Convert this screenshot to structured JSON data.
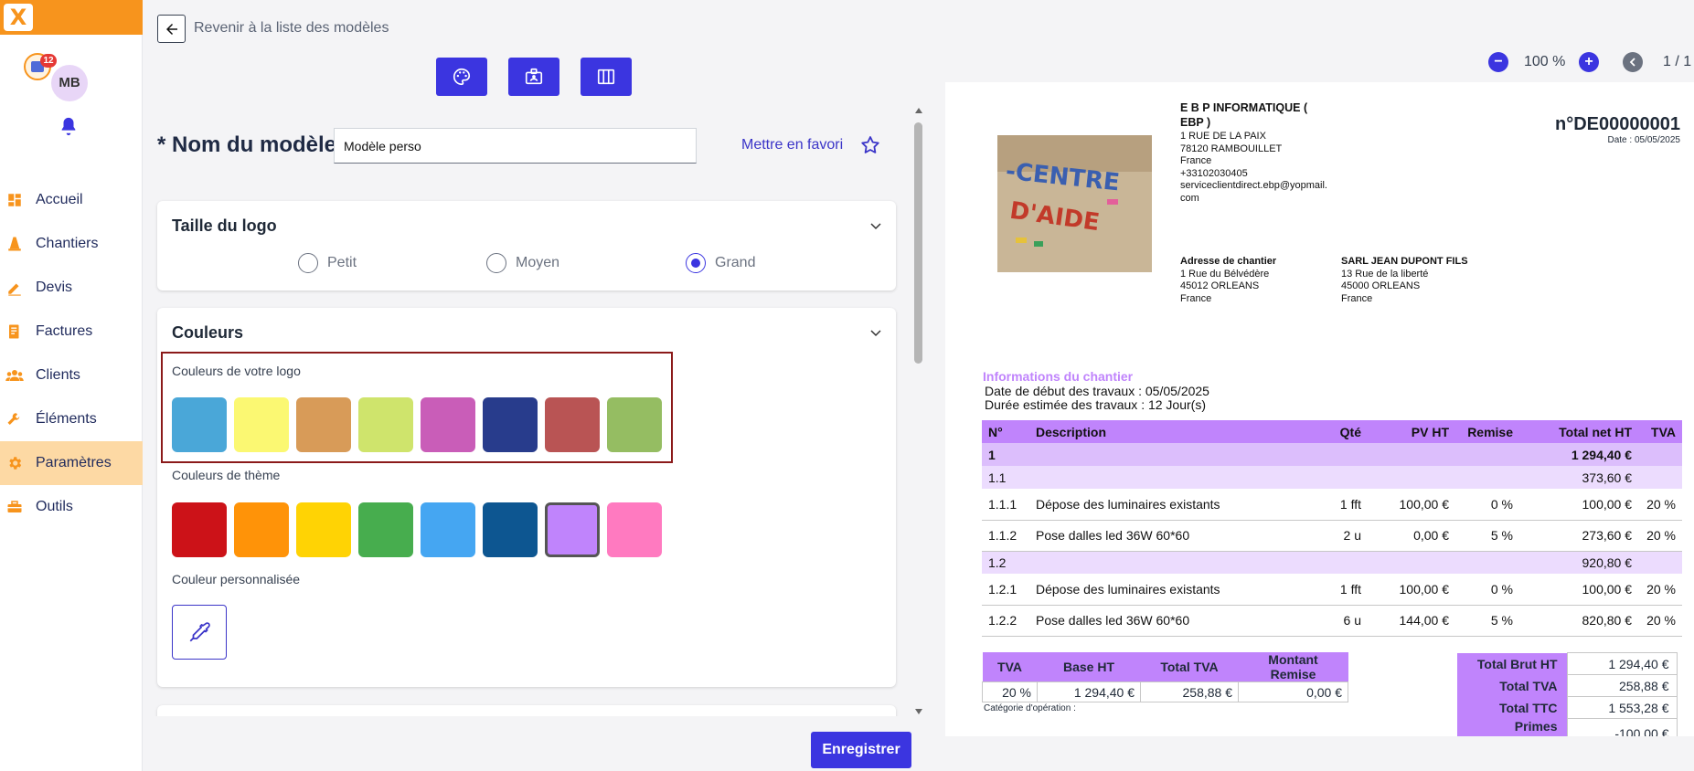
{
  "app": {
    "logo_letter": "X",
    "notif_count": "12",
    "avatar_initials": "MB"
  },
  "nav": [
    {
      "label": "Accueil",
      "icon": "dashboard-icon"
    },
    {
      "label": "Chantiers",
      "icon": "traffic-cone-icon"
    },
    {
      "label": "Devis",
      "icon": "pencil-icon"
    },
    {
      "label": "Factures",
      "icon": "invoice-icon"
    },
    {
      "label": "Clients",
      "icon": "people-icon"
    },
    {
      "label": "Éléments",
      "icon": "tools-icon"
    },
    {
      "label": "Paramètres",
      "icon": "gear-icon",
      "active": true
    },
    {
      "label": "Outils",
      "icon": "toolbox-icon"
    }
  ],
  "topbar": {
    "back_label": "Revenir à la liste des modèles"
  },
  "form": {
    "name_label": "* Nom du modèle",
    "name_value": "Modèle perso",
    "favorite_label": "Mettre en favori"
  },
  "logo_size": {
    "title": "Taille du logo",
    "options": [
      "Petit",
      "Moyen",
      "Grand"
    ],
    "selected": "Grand"
  },
  "colors": {
    "title": "Couleurs",
    "logo_colors_label": "Couleurs de votre logo",
    "logo_colors": [
      "#4aa7d8",
      "#fbf872",
      "#d89b58",
      "#cfe46c",
      "#c95db8",
      "#283c8c",
      "#b95454",
      "#95bd62"
    ],
    "theme_colors_label": "Couleurs de thème",
    "theme_colors": [
      "#cc1218",
      "#ff9308",
      "#ffd304",
      "#47ad4e",
      "#45a6f2",
      "#0d5691",
      "#c084fc",
      "#ff7ac0"
    ],
    "theme_selected_index": 6,
    "custom_label": "Couleur personnalisée"
  },
  "save_label": "Enregistrer",
  "zoom": {
    "minus": "−",
    "value": "100 %",
    "plus": "+",
    "page": "1 / 1"
  },
  "preview": {
    "company_lines": [
      "E B P INFORMATIQUE (",
      "EBP )"
    ],
    "company_addr": [
      "1 RUE DE LA PAIX",
      "78120 RAMBOUILLET",
      "France",
      "+33102030405",
      "serviceclientdirect.ebp@yopmail.",
      "com"
    ],
    "doc_number": "n°DE00000001",
    "doc_date": "Date : 05/05/2025",
    "site_addr_title": "Adresse de chantier",
    "site_addr": [
      "1 Rue du Bélvédère",
      "45012 ORLEANS",
      "France"
    ],
    "client_title": "SARL JEAN DUPONT  FILS",
    "client_addr": [
      "13 Rue de la liberté",
      "45000 ORLEANS",
      "France"
    ],
    "info_title": "Informations du chantier",
    "info_lines": [
      "Date de début des travaux : 05/05/2025",
      "Durée estimée des travaux : 12 Jour(s)"
    ],
    "table_headers": [
      "N°",
      "Description",
      "Qté",
      "PV HT",
      "Remise",
      "Total net HT",
      "TVA"
    ],
    "rows": [
      {
        "type": "lvl1",
        "cells": [
          "1",
          "",
          "",
          "",
          "",
          "1 294,40 €",
          ""
        ]
      },
      {
        "type": "lvl2",
        "cells": [
          "1.1",
          "",
          "",
          "",
          "",
          "373,60 €",
          ""
        ]
      },
      {
        "type": "line",
        "cells": [
          "1.1.1",
          "Dépose des luminaires existants",
          "1 fft",
          "100,00 €",
          "0 %",
          "100,00 €",
          "20 %"
        ]
      },
      {
        "type": "line",
        "cells": [
          "1.1.2",
          "Pose dalles led 36W 60*60",
          "2 u",
          "0,00 €",
          "5 %",
          "273,60 €",
          "20 %"
        ]
      },
      {
        "type": "lvl2",
        "cells": [
          "1.2",
          "",
          "",
          "",
          "",
          "920,80 €",
          ""
        ]
      },
      {
        "type": "line",
        "cells": [
          "1.2.1",
          "Dépose des luminaires existants",
          "1 fft",
          "100,00 €",
          "0 %",
          "100,00 €",
          "20 %"
        ]
      },
      {
        "type": "line",
        "cells": [
          "1.2.2",
          "Pose dalles led 36W 60*60",
          "6 u",
          "144,00 €",
          "5 %",
          "820,80 €",
          "20 %"
        ]
      }
    ],
    "tva_headers": [
      "TVA",
      "Base HT",
      "Total TVA",
      "Montant Remise"
    ],
    "tva_row": [
      "20 %",
      "1 294,40 €",
      "258,88 €",
      "0,00 €"
    ],
    "category_label": "Catégorie d'opération :",
    "totals": [
      {
        "k": "Total Brut HT",
        "v": "1 294,40 €"
      },
      {
        "k": "Total TVA",
        "v": "258,88 €"
      },
      {
        "k": "Total TTC",
        "v": "1 553,28 €"
      },
      {
        "k": "Primes Energie",
        "v": "-100,00 €"
      }
    ]
  }
}
